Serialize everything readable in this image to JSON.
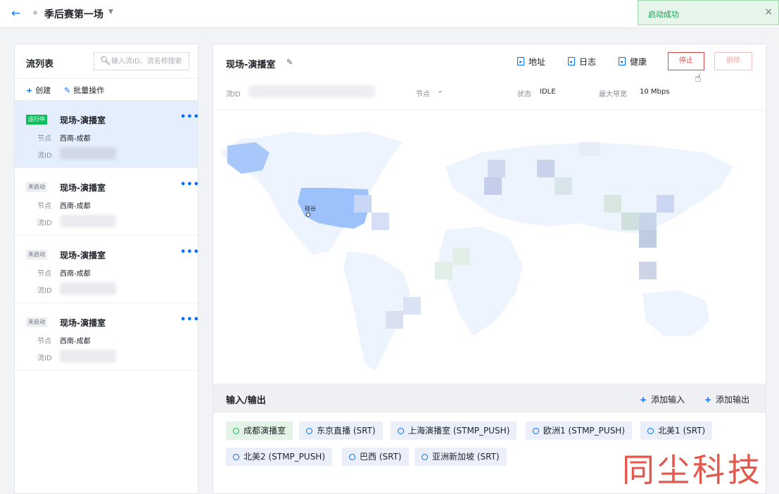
{
  "header": {
    "title": "季后赛第一场",
    "toast": "启动成功"
  },
  "left": {
    "title": "流列表",
    "search_placeholder": "输入流ID、流名称搜索",
    "actions": {
      "create": "创建",
      "batch": "批量操作"
    },
    "items": [
      {
        "status": "运行中",
        "name": "现场-演播室",
        "node_label": "节点",
        "node": "西南-成都",
        "id_label": "流ID"
      },
      {
        "status": "未启动",
        "name": "现场-演播室",
        "node_label": "节点",
        "node": "西南-成都",
        "id_label": "流ID"
      },
      {
        "status": "未启动",
        "name": "现场-演播室",
        "node_label": "节点",
        "node": "西南-成都",
        "id_label": "流ID"
      },
      {
        "status": "未启动",
        "name": "现场-演播室",
        "node_label": "节点",
        "node": "西南-成都",
        "id_label": "流ID"
      }
    ]
  },
  "main": {
    "name": "现场-演播室",
    "tools": {
      "address": "地址",
      "log": "日志",
      "health": "健康"
    },
    "buttons": {
      "stop": "停止",
      "delete": "删除"
    },
    "meta": {
      "id_label": "流ID",
      "node_label": "节点",
      "node": "–",
      "state_label": "状态",
      "state": "IDLE",
      "bw_label": "最大带宽",
      "bw": "10 Mbps"
    },
    "map": {
      "city": "硅谷"
    },
    "io": {
      "title": "输入/输出",
      "add_input": "添加输入",
      "add_output": "添加输出",
      "chips": [
        "成都演播室",
        "东京直播 (SRT)",
        "上海演播室 (STMP_PUSH)",
        "欧洲1 (STMP_PUSH)",
        "北美1 (SRT)",
        "北美2 (STMP_PUSH)",
        "巴西 (SRT)",
        "亚洲新加坡 (SRT)"
      ]
    }
  },
  "watermark": "同尘科技",
  "colors": {
    "accent": "#006eff",
    "running": "#0abf5b",
    "danger": "#e54545"
  }
}
